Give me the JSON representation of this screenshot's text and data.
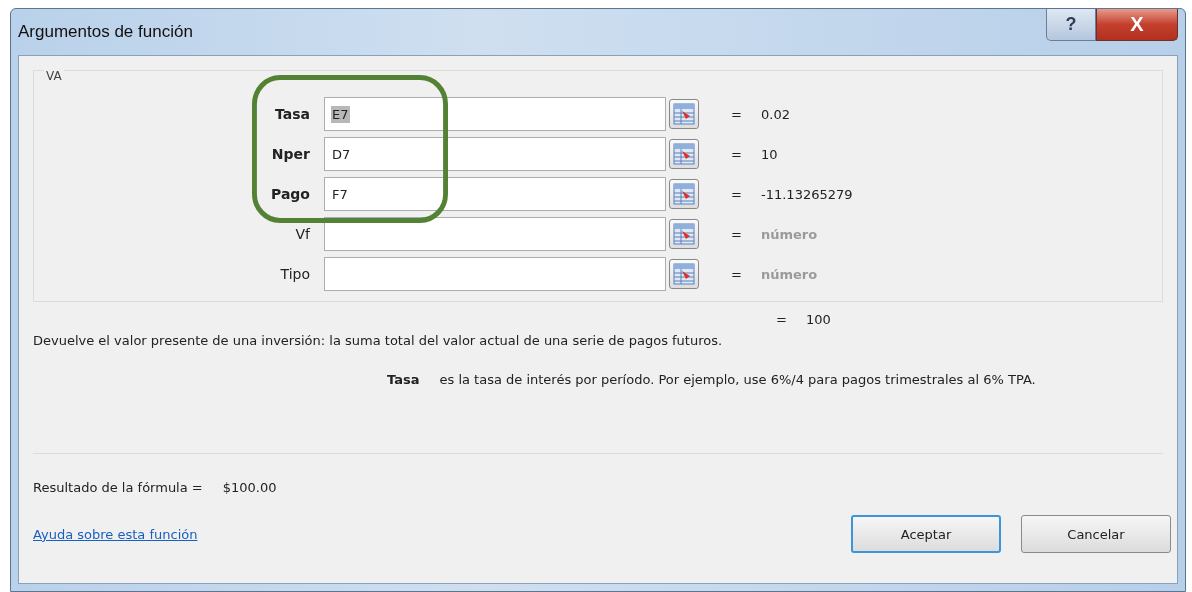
{
  "window": {
    "title": "Argumentos de función",
    "help_button": "?",
    "close_button": "X"
  },
  "group": {
    "title": "VA",
    "arguments": [
      {
        "label": "Tasa",
        "required": true,
        "value": "E7",
        "value_selected": true,
        "result": "0.02",
        "greyed": false
      },
      {
        "label": "Nper",
        "required": true,
        "value": "D7",
        "result": "10",
        "greyed": false
      },
      {
        "label": "Pago",
        "required": true,
        "value": "F7",
        "result": "-11.13265279",
        "greyed": false
      },
      {
        "label": "Vf",
        "required": false,
        "result": "número",
        "greyed": true
      },
      {
        "label": "Tipo",
        "required": false,
        "result": "número",
        "greyed": true
      }
    ]
  },
  "function_result": "100",
  "equals": "=",
  "description": "Devuelve el valor presente de una inversión: la suma total del valor actual de una serie de pagos futuros.",
  "argument_help": {
    "name": "Tasa",
    "text": "es la tasa de interés por período. Por ejemplo, use 6%/4 para pagos trimestrales al 6% TPA."
  },
  "formula_result": {
    "label": "Resultado de la fórmula =",
    "value": "$100.00"
  },
  "help_link": "Ayuda sobre esta función",
  "buttons": [
    {
      "label": "Aceptar",
      "default": true
    },
    {
      "label": "Cancelar",
      "default": false
    }
  ]
}
